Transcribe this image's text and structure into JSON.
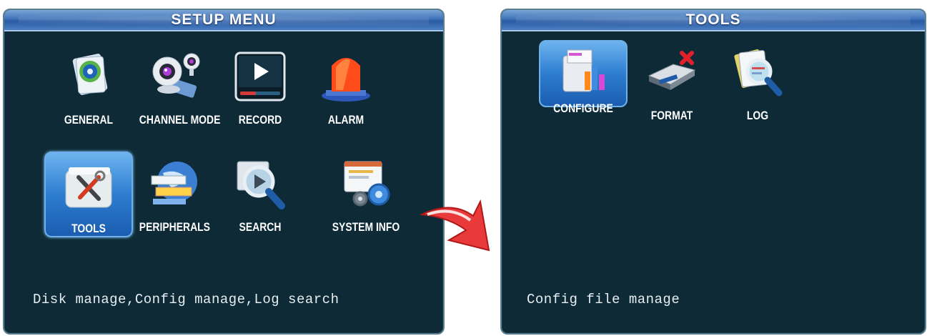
{
  "setup_menu": {
    "title": "SETUP  MENU",
    "items": [
      {
        "label": "GENERAL",
        "icon": "general-gear-icon"
      },
      {
        "label": "CHANNEL MODE",
        "icon": "webcam-icon"
      },
      {
        "label": "RECORD",
        "icon": "play-record-icon"
      },
      {
        "label": "ALARM",
        "icon": "alarm-siren-icon"
      },
      {
        "label": "TOOLS",
        "icon": "tools-icon"
      },
      {
        "label": "PERIPHERALS",
        "icon": "globe-peripherals-icon"
      },
      {
        "label": "SEARCH",
        "icon": "magnifier-search-icon"
      },
      {
        "label": "SYSTEM INFO",
        "icon": "system-info-gears-icon"
      }
    ],
    "selected": "TOOLS",
    "status": "Disk manage,Config manage,Log search"
  },
  "tools_menu": {
    "title": "TOOLS",
    "items": [
      {
        "label": "CONFIGURE",
        "icon": "configure-icon"
      },
      {
        "label": "FORMAT",
        "icon": "format-printer-icon"
      },
      {
        "label": "LOG",
        "icon": "log-magnifier-icon"
      }
    ],
    "selected": "CONFIGURE",
    "status": "Config file manage"
  },
  "colors": {
    "panel_bg": "#0d2a36",
    "title_bar": "#3f72b8",
    "highlight": "#2d7dd0",
    "arrow": "#e0202a"
  }
}
